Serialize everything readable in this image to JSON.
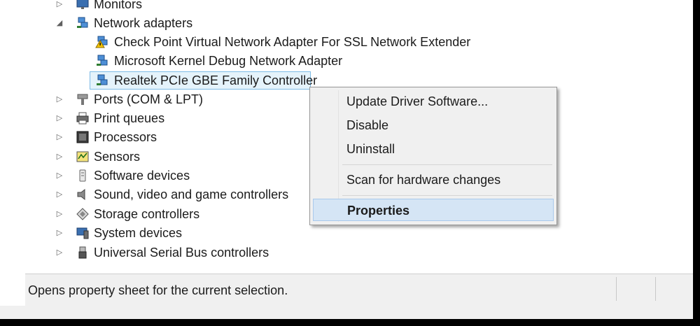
{
  "tree": {
    "items": [
      {
        "label": "Monitors",
        "expanded": false,
        "level": 0,
        "icon": "monitor-icon"
      },
      {
        "label": "Network adapters",
        "expanded": true,
        "level": 0,
        "icon": "network-icon"
      },
      {
        "label": "Check Point Virtual Network Adapter For SSL Network Extender",
        "level": 1,
        "icon": "network-warning-icon"
      },
      {
        "label": "Microsoft Kernel Debug Network Adapter",
        "level": 1,
        "icon": "network-icon"
      },
      {
        "label": "Realtek PCIe GBE Family Controller",
        "level": 1,
        "icon": "network-icon",
        "selected": true
      },
      {
        "label": "Ports (COM & LPT)",
        "expanded": false,
        "level": 0,
        "icon": "port-icon"
      },
      {
        "label": "Print queues",
        "expanded": false,
        "level": 0,
        "icon": "printer-icon"
      },
      {
        "label": "Processors",
        "expanded": false,
        "level": 0,
        "icon": "processor-icon"
      },
      {
        "label": "Sensors",
        "expanded": false,
        "level": 0,
        "icon": "sensor-icon"
      },
      {
        "label": "Software devices",
        "expanded": false,
        "level": 0,
        "icon": "software-device-icon"
      },
      {
        "label": "Sound, video and game controllers",
        "expanded": false,
        "level": 0,
        "icon": "speaker-icon"
      },
      {
        "label": "Storage controllers",
        "expanded": false,
        "level": 0,
        "icon": "storage-icon"
      },
      {
        "label": "System devices",
        "expanded": false,
        "level": 0,
        "icon": "system-device-icon"
      },
      {
        "label": "Universal Serial Bus controllers",
        "expanded": false,
        "level": 0,
        "icon": "usb-icon"
      }
    ]
  },
  "context_menu": {
    "items": [
      {
        "label": "Update Driver Software...",
        "bold": false
      },
      {
        "label": "Disable",
        "bold": false
      },
      {
        "label": "Uninstall",
        "bold": false
      },
      {
        "label": "Scan for hardware changes",
        "bold": false
      },
      {
        "label": "Properties",
        "bold": true,
        "highlighted": true
      }
    ]
  },
  "status_bar": {
    "text": "Opens property sheet for the current selection."
  },
  "colors": {
    "selection_bg": "#e5f3fb",
    "selection_border": "#7dbbe6",
    "menu_bg": "#f0f0f0",
    "menu_hover": "#d5e5f5"
  }
}
